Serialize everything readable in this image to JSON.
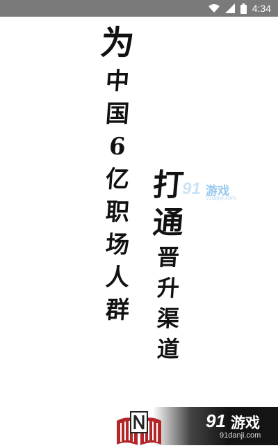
{
  "status_bar": {
    "time": "4:34",
    "icons": [
      "wifi-icon",
      "signal-icon",
      "battery-icon"
    ],
    "background": "#7a7a7a"
  },
  "splash": {
    "left_column": {
      "lead": "为",
      "chars": [
        "中",
        "国",
        "6",
        "亿",
        "职",
        "场",
        "人",
        "群"
      ]
    },
    "right_column": {
      "lead": [
        "打",
        "通"
      ],
      "chars": [
        "晋",
        "升",
        "渠",
        "道"
      ]
    }
  },
  "watermark_middle": {
    "number": "91",
    "name": "游戏",
    "url": "91danji.com"
  },
  "watermark_bottom": {
    "number": "91",
    "name": "游戏",
    "url": "91danji.com"
  },
  "colors": {
    "ink": "#111111",
    "logo_red": "#b3262a",
    "watermark_blue": "#3f9be0"
  }
}
